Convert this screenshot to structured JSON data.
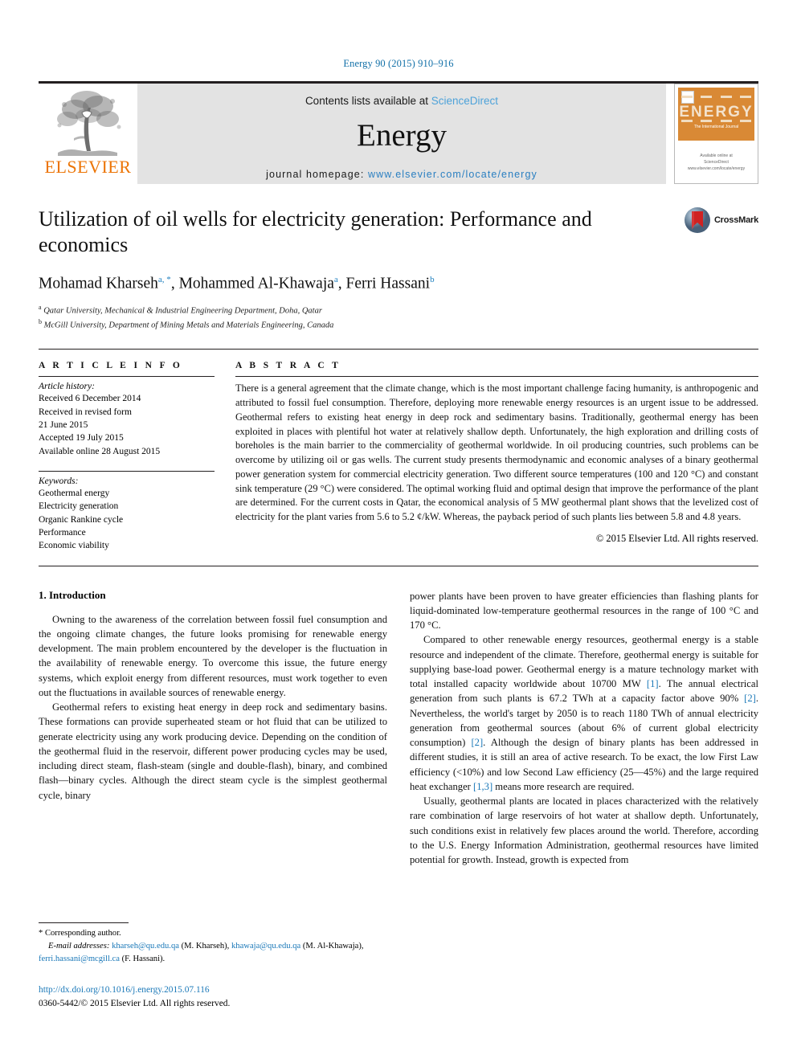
{
  "journal_ref": "Energy 90 (2015) 910–916",
  "masthead": {
    "elsevier_wordmark": "ELSEVIER",
    "contents_prefix": "Contents lists available at ",
    "contents_link": "ScienceDirect",
    "journal_name": "Energy",
    "homepage_prefix": "journal homepage: ",
    "homepage_url": "www.elsevier.com/locate/energy",
    "cover": {
      "title": "ENERGY",
      "subtitle": "The International Journal",
      "bottom_line1": "Available online at",
      "bottom_line2": "ScienceDirect",
      "bottom_line3": "www.elsevier.com/locate/energy"
    }
  },
  "article": {
    "title": "Utilization of oil wells for electricity generation: Performance and economics",
    "authors": [
      {
        "name": "Mohamad Kharseh",
        "sup": "a, *"
      },
      {
        "name": "Mohammed Al-Khawaja",
        "sup": "a"
      },
      {
        "name": "Ferri Hassani",
        "sup": "b"
      }
    ],
    "affiliations": [
      {
        "marker": "a",
        "text": "Qatar University, Mechanical & Industrial Engineering Department, Doha, Qatar"
      },
      {
        "marker": "b",
        "text": "McGill University, Department of Mining Metals and Materials Engineering, Canada"
      }
    ],
    "crossmark_label": "CrossMark"
  },
  "article_info": {
    "heading": "A R T I C L E   I N F O",
    "history_label": "Article history:",
    "history": [
      "Received 6 December 2014",
      "Received in revised form",
      "21 June 2015",
      "Accepted 19 July 2015",
      "Available online 28 August 2015"
    ],
    "keywords_label": "Keywords:",
    "keywords": [
      "Geothermal energy",
      "Electricity generation",
      "Organic Rankine cycle",
      "Performance",
      "Economic viability"
    ]
  },
  "abstract": {
    "heading": "A B S T R A C T",
    "text": "There is a general agreement that the climate change, which is the most important challenge facing humanity, is anthropogenic and attributed to fossil fuel consumption. Therefore, deploying more renewable energy resources is an urgent issue to be addressed. Geothermal refers to existing heat energy in deep rock and sedimentary basins. Traditionally, geothermal energy has been exploited in places with plentiful hot water at relatively shallow depth. Unfortunately, the high exploration and drilling costs of boreholes is the main barrier to the commerciality of geothermal worldwide. In oil producing countries, such problems can be overcome by utilizing oil or gas wells. The current study presents thermodynamic and economic analyses of a binary geothermal power generation system for commercial electricity generation. Two different source temperatures (100 and 120 °C) and constant sink temperature (29 °C) were considered. The optimal working fluid and optimal design that improve the performance of the plant are determined. For the current costs in Qatar, the economical analysis of 5 MW geothermal plant shows that the levelized cost of electricity for the plant varies from 5.6 to 5.2 ¢/kW. Whereas, the payback period of such plants lies between 5.8 and 4.8 years.",
    "copyright": "© 2015 Elsevier Ltd. All rights reserved."
  },
  "body": {
    "section_number_title": "1. Introduction",
    "left_paragraphs": [
      "Owning to the awareness of the correlation between fossil fuel consumption and the ongoing climate changes, the future looks promising for renewable energy development. The main problem encountered by the developer is the fluctuation in the availability of renewable energy. To overcome this issue, the future energy systems, which exploit energy from different resources, must work together to even out the fluctuations in available sources of renewable energy.",
      "Geothermal refers to existing heat energy in deep rock and sedimentary basins. These formations can provide superheated steam or hot fluid that can be utilized to generate electricity using any work producing device. Depending on the condition of the geothermal fluid in the reservoir, different power producing cycles may be used, including direct steam, flash-steam (single and double-flash), binary, and combined flash—binary cycles. Although the direct steam cycle is the simplest geothermal cycle, binary"
    ],
    "right_paragraph_1": "power plants have been proven to have greater efficiencies than flashing plants for liquid-dominated low-temperature geothermal resources in the range of 100 °C and 170 °C.",
    "right_paragraph_2_parts": [
      {
        "t": "Compared to other renewable energy resources, geothermal energy is a stable resource and independent of the climate. Therefore, geothermal energy is suitable for supplying base-load power. Geothermal energy is a mature technology market with total installed capacity worldwide about 10700 MW "
      },
      {
        "t": "[1]",
        "ref": true
      },
      {
        "t": ". The annual electrical generation from such plants is 67.2 TWh at a capacity factor above 90% "
      },
      {
        "t": "[2]",
        "ref": true
      },
      {
        "t": ". Nevertheless, the world's target by 2050 is to reach 1180 TWh of annual electricity generation from geothermal sources (about 6% of current global electricity consumption) "
      },
      {
        "t": "[2]",
        "ref": true
      },
      {
        "t": ". Although the design of binary plants has been addressed in different studies, it is still an area of active research. To be exact, the low First Law efficiency (<10%) and low Second Law efficiency (25—45%) and the large required heat exchanger "
      },
      {
        "t": "[1,3]",
        "ref": true
      },
      {
        "t": " means more research are required."
      }
    ],
    "right_paragraph_3": "Usually, geothermal plants are located in places characterized with the relatively rare combination of large reservoirs of hot water at shallow depth. Unfortunately, such conditions exist in relatively few places around the world. Therefore, according to the U.S. Energy Information Administration, geothermal resources have limited potential for growth. Instead, growth is expected from"
  },
  "footnote": {
    "corresponding": "* Corresponding author.",
    "email_label": "E-mail addresses:",
    "emails": [
      {
        "address": "kharseh@qu.edu.qa",
        "owner": "(M. Kharseh),"
      },
      {
        "address": "khawaja@qu.edu.qa",
        "owner": "(M. Al-Khawaja),"
      },
      {
        "address": "ferri.hassani@mcgill.ca",
        "owner": "(F. Hassani)."
      }
    ]
  },
  "doi_block": {
    "doi_url": "http://dx.doi.org/10.1016/j.energy.2015.07.116",
    "issn_line": "0360-5442/© 2015 Elsevier Ltd. All rights reserved."
  },
  "colors": {
    "link_blue": "#1a78b8",
    "elsevier_orange": "#ec7404",
    "sciencedirect_blue": "#4da2d9",
    "cover_orange": "#d98935"
  }
}
